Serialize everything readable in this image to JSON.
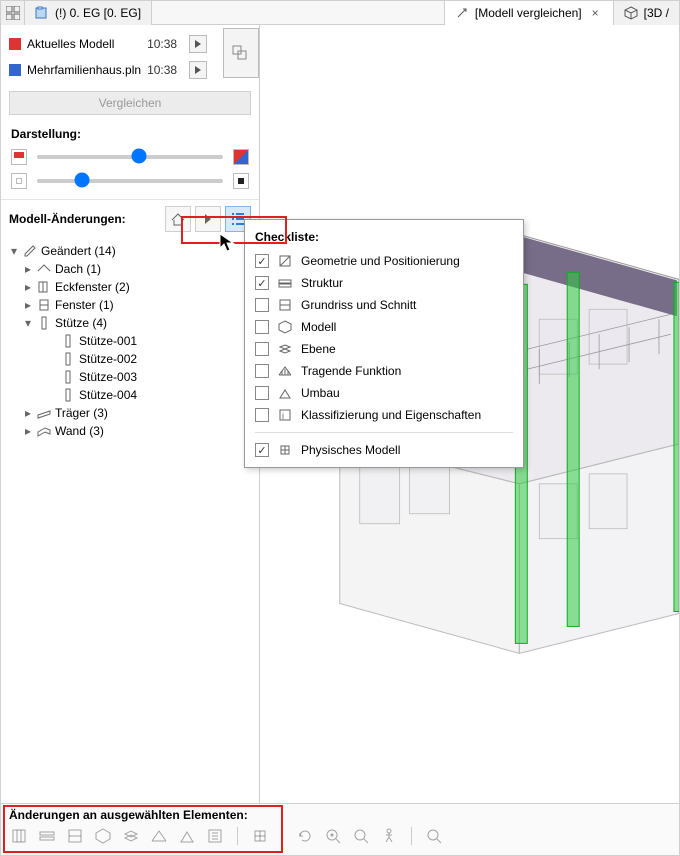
{
  "tabs": {
    "left_icon": "thumbnails-icon",
    "tab1": {
      "label": "(!) 0. EG [0. EG]",
      "icon": "plan-icon"
    },
    "tab2": {
      "label": "[Modell vergleichen]",
      "icon": "compare-icon"
    },
    "tab3": {
      "label": "[3D / ",
      "icon": "cube-icon"
    }
  },
  "header": {
    "model_a": {
      "name": "Aktuelles Modell",
      "time": "10:38",
      "color": "#d33333"
    },
    "model_b": {
      "name": "Mehrfamilienhaus.pln",
      "time": "10:38",
      "color": "#3366cc"
    },
    "compare_label": "Vergleichen"
  },
  "display": {
    "title": "Darstellung:",
    "slider1_value": 55,
    "slider2_value": 22
  },
  "changes": {
    "title": "Modell-Änderungen:"
  },
  "tree": {
    "root": {
      "label": "Geändert (14)",
      "expanded": true
    },
    "items": [
      {
        "label": "Dach (1)",
        "icon": "roof-icon",
        "expanded": false
      },
      {
        "label": "Eckfenster (2)",
        "icon": "cornerwin-icon",
        "expanded": false
      },
      {
        "label": "Fenster (1)",
        "icon": "window-icon",
        "expanded": false
      },
      {
        "label": "Stütze (4)",
        "icon": "column-icon",
        "expanded": true,
        "children": [
          "Stütze-001",
          "Stütze-002",
          "Stütze-003",
          "Stütze-004"
        ]
      },
      {
        "label": "Träger (3)",
        "icon": "beam-icon",
        "expanded": false
      },
      {
        "label": "Wand (3)",
        "icon": "wall-icon",
        "expanded": false
      }
    ]
  },
  "checklist": {
    "title": "Checkliste:",
    "items": [
      {
        "label": "Geometrie und Positionierung",
        "checked": true,
        "icon": "geometry-icon"
      },
      {
        "label": "Struktur",
        "checked": true,
        "icon": "structure-icon"
      },
      {
        "label": "Grundriss und Schnitt",
        "checked": false,
        "icon": "plan-icon"
      },
      {
        "label": "Modell",
        "checked": false,
        "icon": "model-icon"
      },
      {
        "label": "Ebene",
        "checked": false,
        "icon": "layer-icon"
      },
      {
        "label": "Tragende Funktion",
        "checked": false,
        "icon": "structural-icon"
      },
      {
        "label": "Umbau",
        "checked": false,
        "icon": "renovation-icon"
      },
      {
        "label": "Klassifizierung und Eigenschaften",
        "checked": false,
        "icon": "classify-icon"
      }
    ],
    "separator_item": {
      "label": "Physisches Modell",
      "checked": true,
      "icon": "physical-icon"
    }
  },
  "bottom": {
    "title": "Änderungen an ausgewählten Elementen:"
  }
}
